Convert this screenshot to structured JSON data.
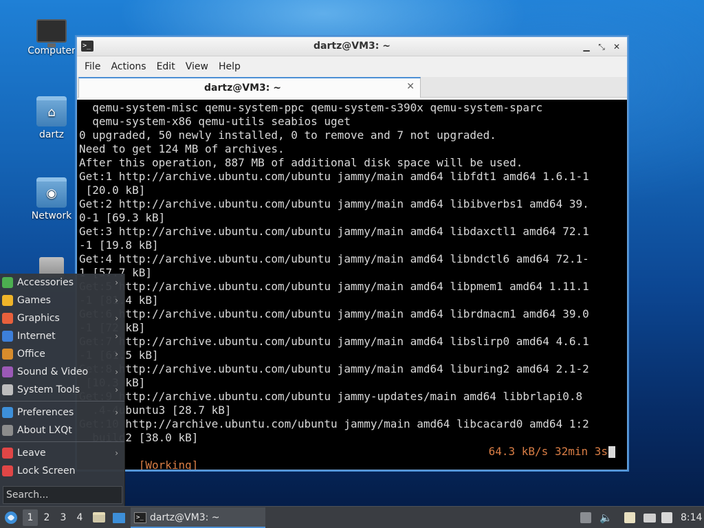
{
  "desktop": {
    "icons": [
      {
        "label": "Computer",
        "icon": "computer-icon"
      },
      {
        "label": "dartz",
        "icon": "home-folder-icon"
      },
      {
        "label": "Network",
        "icon": "network-folder-icon"
      },
      {
        "label": "",
        "icon": "trash-icon"
      }
    ]
  },
  "window": {
    "title": "dartz@VM3: ~",
    "controls": {
      "minimize": "▁",
      "restore": "⤡",
      "close": "✕"
    },
    "menu": [
      "File",
      "Actions",
      "Edit",
      "View",
      "Help"
    ],
    "tab": {
      "label": "dartz@VM3: ~",
      "close": "✕"
    }
  },
  "terminal": {
    "lines": [
      "  qemu-system-misc qemu-system-ppc qemu-system-s390x qemu-system-sparc",
      "  qemu-system-x86 qemu-utils seabios uget",
      "0 upgraded, 50 newly installed, 0 to remove and 7 not upgraded.",
      "Need to get 124 MB of archives.",
      "After this operation, 887 MB of additional disk space will be used.",
      "Get:1 http://archive.ubuntu.com/ubuntu jammy/main amd64 libfdt1 amd64 1.6.1-1",
      " [20.0 kB]",
      "Get:2 http://archive.ubuntu.com/ubuntu jammy/main amd64 libibverbs1 amd64 39.",
      "0-1 [69.3 kB]",
      "Get:3 http://archive.ubuntu.com/ubuntu jammy/main amd64 libdaxctl1 amd64 72.1",
      "-1 [19.8 kB]",
      "Get:4 http://archive.ubuntu.com/ubuntu jammy/main amd64 libndctl6 amd64 72.1-",
      "1 [57.7 kB]",
      "Get:5 http://archive.ubuntu.com/ubuntu jammy/main amd64 libpmem1 amd64 1.11.1",
      "-1 [81.4 kB]",
      "Get:6 http://archive.ubuntu.com/ubuntu jammy/main amd64 librdmacm1 amd64 39.0",
      "-1 [72 kB]",
      "Get:7 http://archive.ubuntu.com/ubuntu jammy/main amd64 libslirp0 amd64 4.6.1",
      "-1 [61.5 kB]",
      "Get:8 http://archive.ubuntu.com/ubuntu jammy/main amd64 liburing2 amd64 2.1-2",
      " [10.3 kB]",
      "Get:9 http://archive.ubuntu.com/ubuntu jammy-updates/main amd64 libbrlapi0.8",
      "  .4-4ubuntu3 [28.7 kB]",
      "Get:10 http://archive.ubuntu.com/ubuntu jammy/main amd64 libcacard0 amd64 1:2",
      "  build2 [38.0 kB]"
    ],
    "status_left": "   [Working]",
    "status_right": "64.3 kB/s 32min 3s"
  },
  "start_menu": {
    "groups": [
      [
        {
          "label": "Accessories",
          "icon": "accessories-icon",
          "color": "#4caf50",
          "submenu": true
        },
        {
          "label": "Games",
          "icon": "games-icon",
          "color": "#f0b429",
          "submenu": true
        },
        {
          "label": "Graphics",
          "icon": "graphics-icon",
          "color": "#e8603c",
          "submenu": true
        },
        {
          "label": "Internet",
          "icon": "internet-icon",
          "color": "#3d7fd9",
          "submenu": true
        },
        {
          "label": "Office",
          "icon": "office-icon",
          "color": "#d88c2c",
          "submenu": true
        },
        {
          "label": "Sound & Video",
          "icon": "sound-video-icon",
          "color": "#9b59b6",
          "submenu": true
        },
        {
          "label": "System Tools",
          "icon": "system-tools-icon",
          "color": "#bdbdbd",
          "submenu": true
        }
      ],
      [
        {
          "label": "Preferences",
          "icon": "preferences-icon",
          "color": "#3d8fd9",
          "submenu": true
        },
        {
          "label": "About LXQt",
          "icon": "info-icon",
          "color": "#8c8c8c",
          "submenu": false
        }
      ],
      [
        {
          "label": "Leave",
          "icon": "power-icon",
          "color": "#e04646",
          "submenu": true
        },
        {
          "label": "Lock Screen",
          "icon": "lock-icon",
          "color": "#e04646",
          "submenu": false
        }
      ]
    ],
    "search_placeholder": "Search..."
  },
  "taskbar": {
    "workspaces": [
      "1",
      "2",
      "3",
      "4"
    ],
    "active_workspace": "1",
    "task_label": "dartz@VM3: ~",
    "clock": "8:14",
    "accent": "#4b8fd4"
  }
}
